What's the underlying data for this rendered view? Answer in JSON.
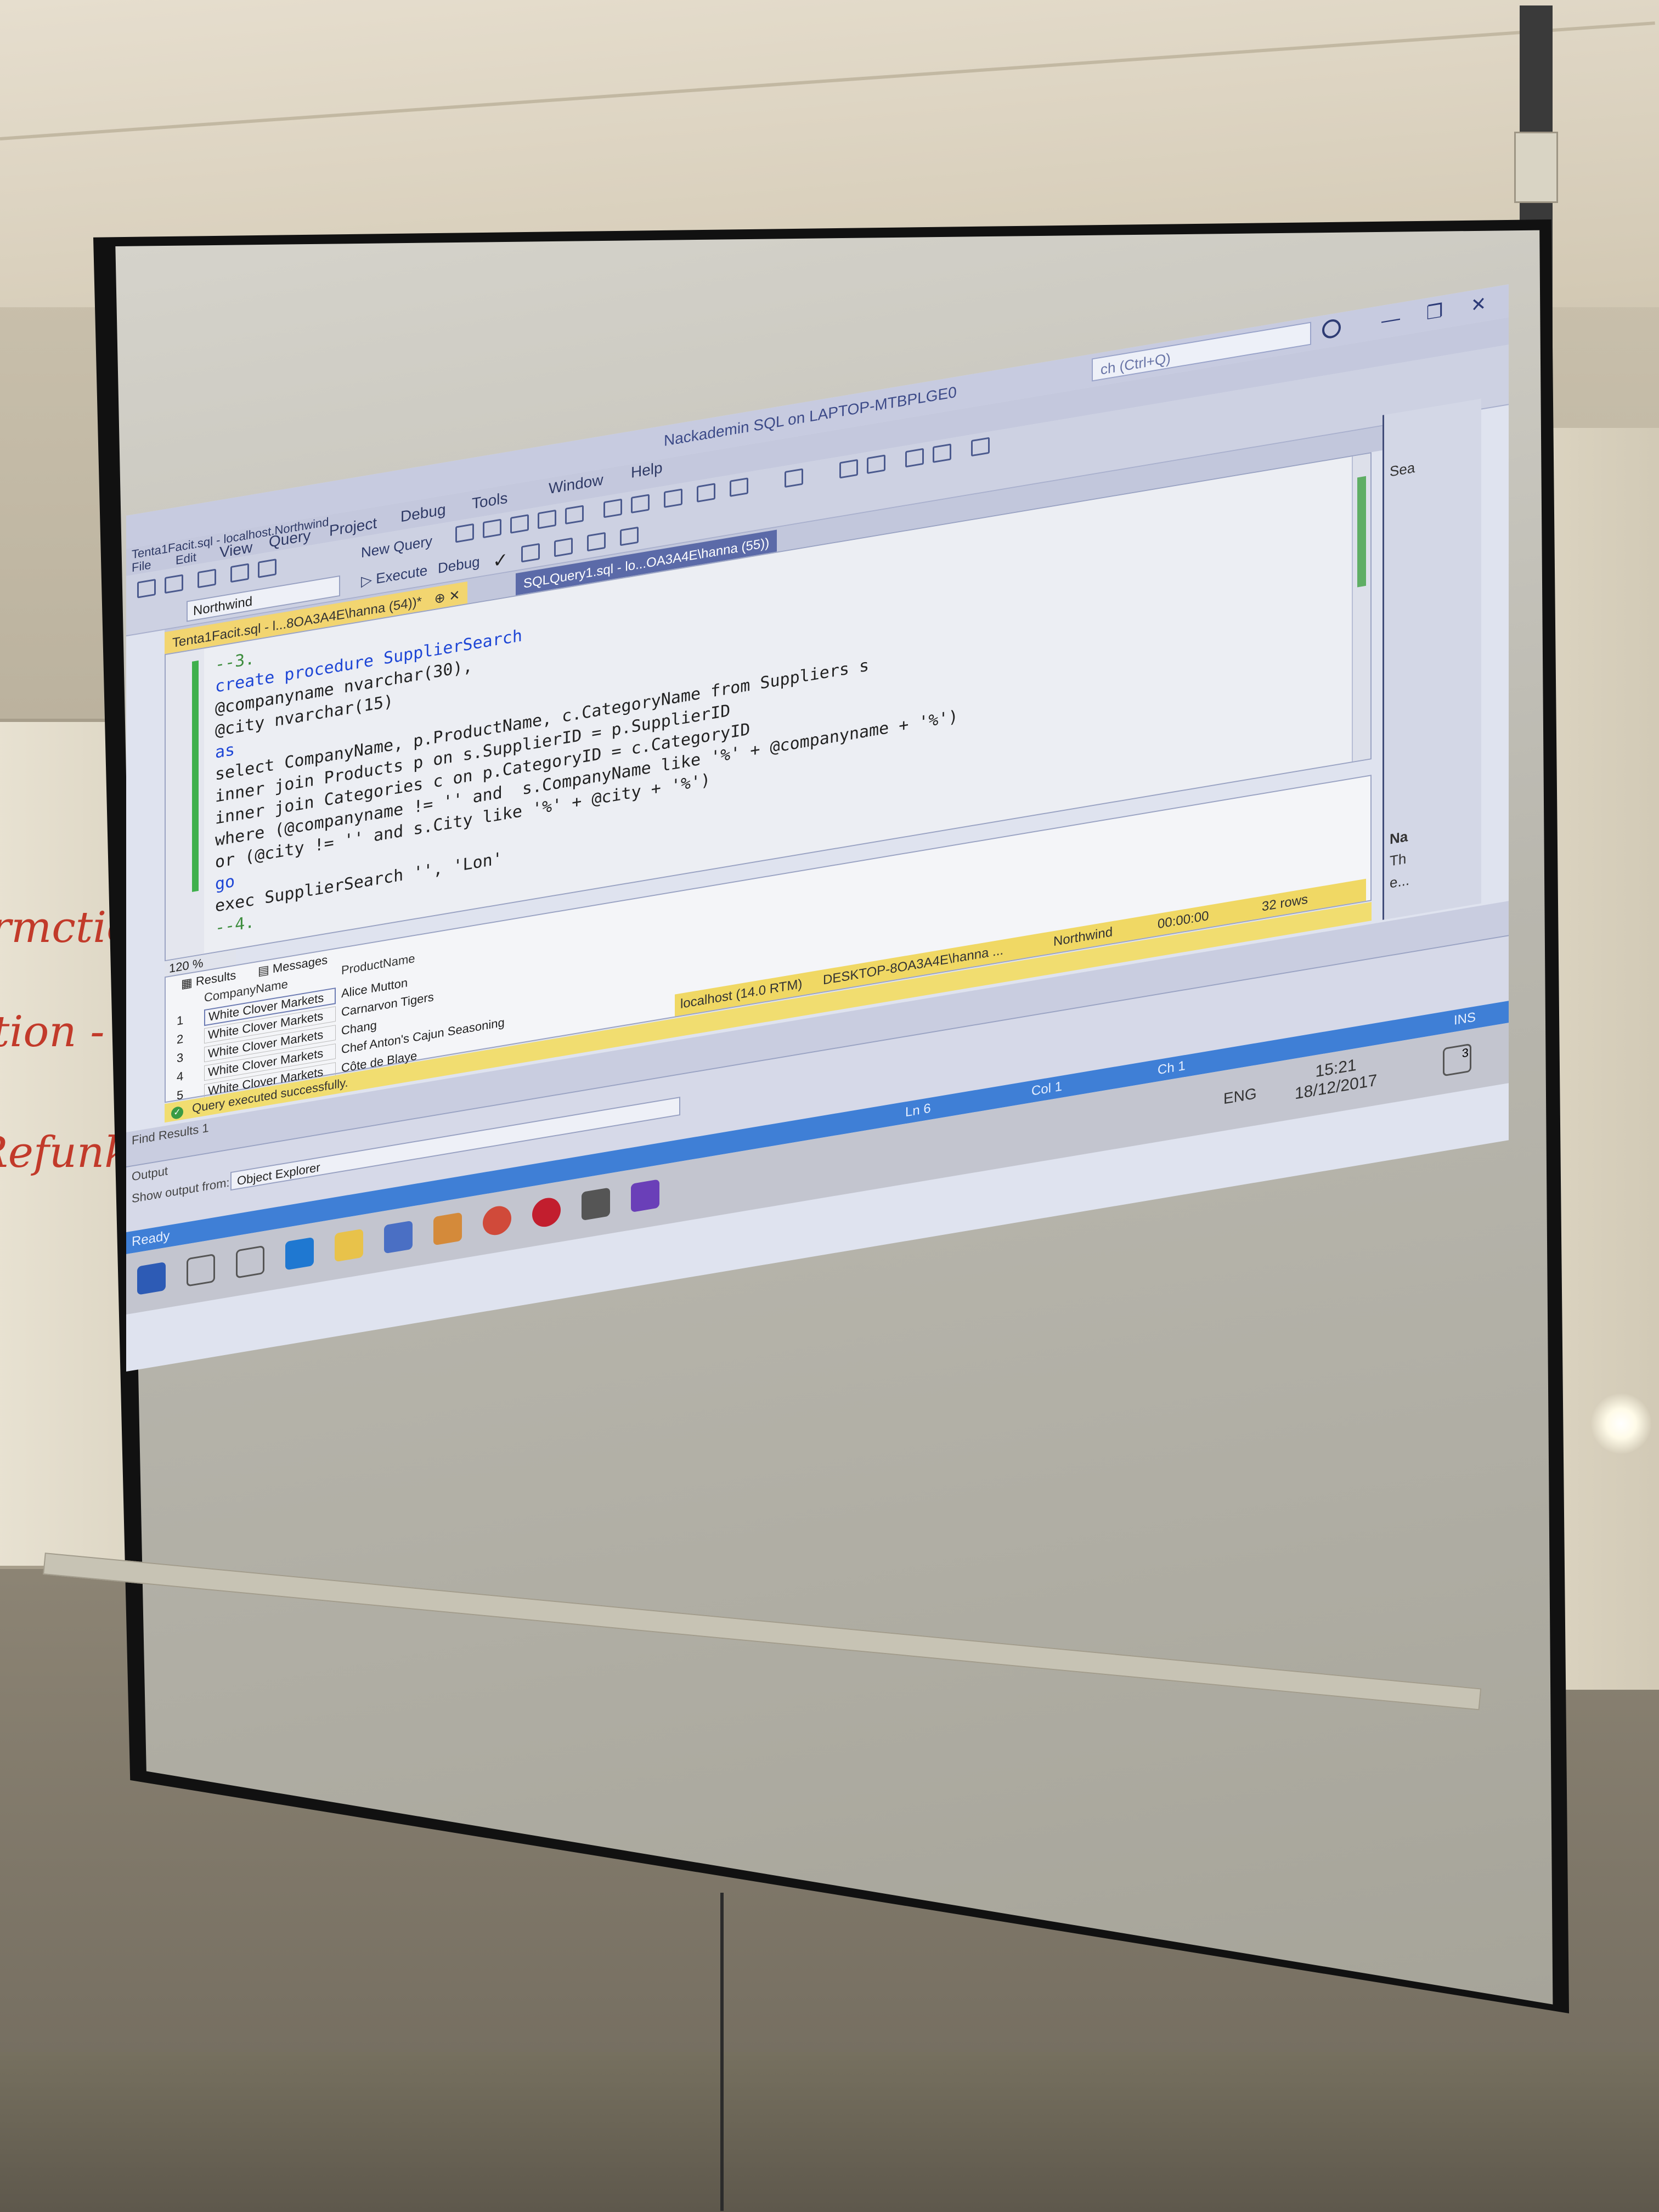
{
  "window": {
    "title": "Nackademin SQL on LAPTOP-MTBPLGE0",
    "quick_launch": "ch (Ctrl+Q)",
    "minimize": "—",
    "restore": "❐",
    "close": "✕"
  },
  "tab_title": "Tenta1Facit.sql - localhost.Northwind",
  "menu": [
    "File",
    "Edit",
    "View",
    "Query",
    "Project",
    "Debug",
    "Tools",
    "Window",
    "Help"
  ],
  "toolbar": {
    "new_query": "New Query",
    "execute": "Execute",
    "debug": "Debug",
    "database": "Northwind"
  },
  "tabs": [
    {
      "label": "Tenta1Facit.sql - l...8OA3A4E\\hanna (54))*",
      "active": true
    },
    {
      "label": "SQLQuery1.sql - lo...OA3A4E\\hanna (55))",
      "active": false
    }
  ],
  "editor": {
    "zoom": "120 %",
    "lines": [
      {
        "t": "--3.",
        "c": "cm"
      },
      {
        "t": "",
        "c": ""
      },
      {
        "t": "create procedure SupplierSearch",
        "c": "kw"
      },
      {
        "t": "@companyname nvarchar(30),",
        "c": ""
      },
      {
        "t": "@city nvarchar(15)",
        "c": ""
      },
      {
        "t": "as",
        "c": "kw"
      },
      {
        "t": "select CompanyName, p.ProductName, c.CategoryName from Suppliers s",
        "c": ""
      },
      {
        "t": "inner join Products p on s.SupplierID = p.SupplierID",
        "c": ""
      },
      {
        "t": "inner join Categories c on p.CategoryID = c.CategoryID",
        "c": ""
      },
      {
        "t": "where (@companyname != '' and  s.CompanyName like '%' + @companyname + '%')",
        "c": ""
      },
      {
        "t": "or (@city != '' and s.City like '%' + @city + '%')",
        "c": ""
      },
      {
        "t": "go",
        "c": "kw"
      },
      {
        "t": "",
        "c": ""
      },
      {
        "t": "exec SupplierSearch '', 'Lon'",
        "c": ""
      },
      {
        "t": "",
        "c": ""
      },
      {
        "t": "--4.",
        "c": "cm"
      }
    ]
  },
  "results": {
    "tab_results": "Results",
    "tab_messages": "Messages",
    "columns": [
      "CompanyName",
      "ProductName"
    ],
    "rows": [
      {
        "n": "1",
        "company": "White Clover Markets",
        "product": "Alice Mutton"
      },
      {
        "n": "2",
        "company": "White Clover Markets",
        "product": "Carnarvon Tigers"
      },
      {
        "n": "3",
        "company": "White Clover Markets",
        "product": "Chang"
      },
      {
        "n": "4",
        "company": "White Clover Markets",
        "product": "Chef Anton's Cajun Seasoning"
      },
      {
        "n": "5",
        "company": "White Clover Markets",
        "product": "Côte de Blaye"
      }
    ]
  },
  "query_status": {
    "message": "Query executed successfully.",
    "server": "localhost (14.0 RTM)",
    "user": "DESKTOP-8OA3A4E\\hanna ...",
    "database": "Northwind",
    "time": "00:00:00",
    "rows": "32 rows"
  },
  "find_results": {
    "label": "Find Results 1"
  },
  "output": {
    "label": "Output",
    "show_from": "Show output from:",
    "source": "Object Explorer"
  },
  "statusbar": {
    "ready": "Ready",
    "ln": "Ln 6",
    "col": "Col 1",
    "ch": "Ch 1",
    "mode": "INS"
  },
  "taskbar": {
    "lang": "ENG",
    "time": "15:21",
    "date": "18/12/2017",
    "notifications": "3"
  },
  "side_panel": {
    "search": "Sea",
    "name_label": "Na",
    "text1": "Th",
    "text2": "e..."
  },
  "whiteboard": [
    "ormctio",
    "stion -",
    "Refunk"
  ]
}
